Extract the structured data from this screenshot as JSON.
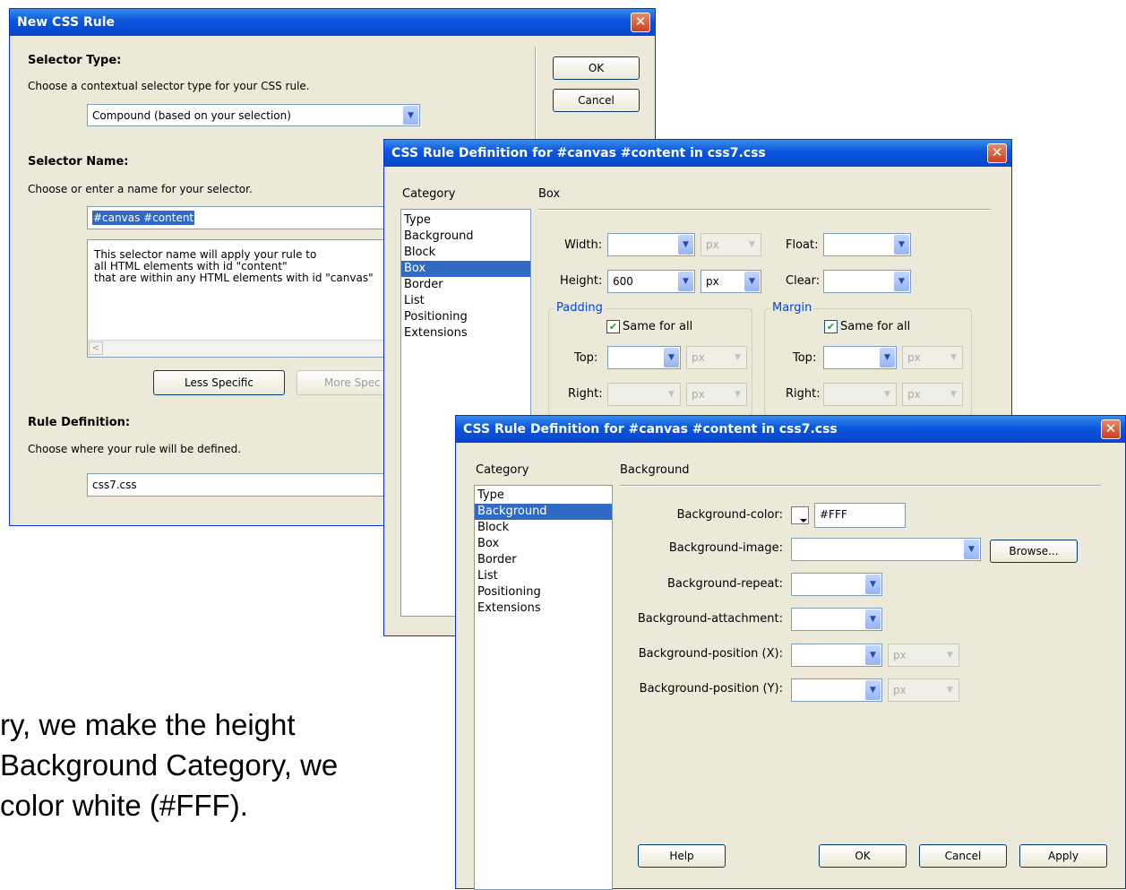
{
  "caption": {
    "line1": "ry, we make the height",
    "line2": "Background Category, we",
    "line3": "color white (#FFF)."
  },
  "dialog1": {
    "title": "New CSS Rule",
    "close_glyph": "✕",
    "ok_label": "OK",
    "cancel_label": "Cancel",
    "selector_type_heading": "Selector Type:",
    "selector_type_desc": "Choose a contextual selector type for your CSS rule.",
    "selector_type_value": "Compound (based on your selection)",
    "selector_name_heading": "Selector Name:",
    "selector_name_desc": "Choose or enter a name for your selector.",
    "selector_name_value": "#canvas #content",
    "description_lines": [
      "This selector name will apply your rule to",
      "all HTML elements with id \"content\"",
      "that are within any HTML elements with id \"canvas\""
    ],
    "less_specific_label": "Less Specific",
    "more_specific_label": "More Spec",
    "rule_def_heading": "Rule Definition:",
    "rule_def_desc": "Choose where your rule will be defined.",
    "rule_def_value": "css7.css"
  },
  "dialog2": {
    "title": "CSS Rule Definition for #canvas #content in css7.css",
    "category_label": "Category",
    "section_label": "Box",
    "categories": [
      "Type",
      "Background",
      "Block",
      "Box",
      "Border",
      "List",
      "Positioning",
      "Extensions"
    ],
    "selected_category": "Box",
    "width_label": "Width:",
    "width_value": "",
    "width_unit": "px",
    "height_label": "Height:",
    "height_value": "600",
    "height_unit": "px",
    "float_label": "Float:",
    "clear_label": "Clear:",
    "padding_label": "Padding",
    "margin_label": "Margin",
    "same_for_all_label": "Same for all",
    "top_label": "Top:",
    "right_label": "Right:",
    "unit_px": "px"
  },
  "dialog3": {
    "title": "CSS Rule Definition for #canvas #content in css7.css",
    "category_label": "Category",
    "section_label": "Background",
    "categories": [
      "Type",
      "Background",
      "Block",
      "Box",
      "Border",
      "List",
      "Positioning",
      "Extensions"
    ],
    "selected_category": "Background",
    "bg_color_label": "Background-color:",
    "bg_color_value": "#FFF",
    "bg_image_label": "Background-image:",
    "browse_label": "Browse...",
    "bg_repeat_label": "Background-repeat:",
    "bg_attachment_label": "Background-attachment:",
    "bg_pos_x_label": "Background-position (X):",
    "bg_pos_y_label": "Background-position (Y):",
    "unit_px": "px",
    "help_label": "Help",
    "ok_label": "OK",
    "cancel_label": "Cancel",
    "apply_label": "Apply"
  }
}
